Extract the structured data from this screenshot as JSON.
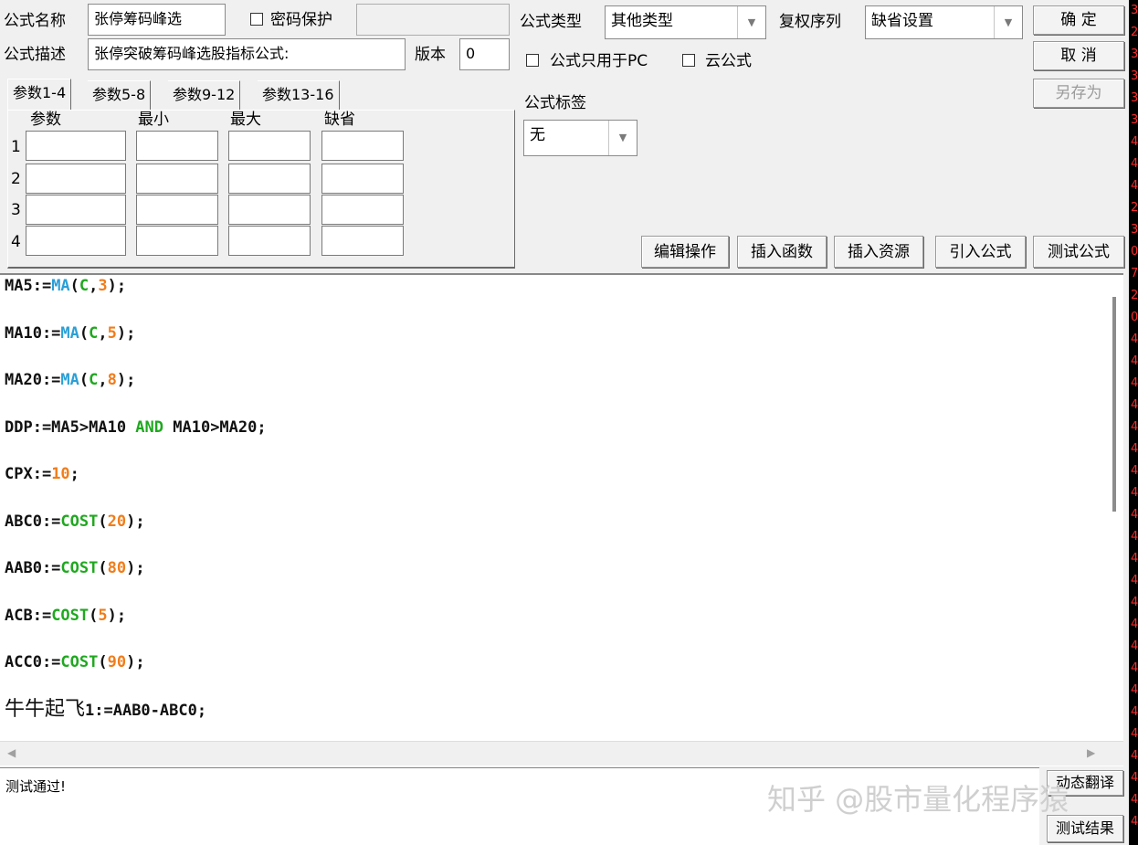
{
  "formula": {
    "name_label": "公式名称",
    "name_value": "张停筹码峰选",
    "password_label": "密码保护",
    "desc_label": "公式描述",
    "desc_value": "张停突破筹码峰选股指标公式:",
    "version_label": "版本",
    "version_value": "0",
    "type_label": "公式类型",
    "type_value": "其他类型",
    "restore_label": "复权序列",
    "restore_value": "缺省设置",
    "pc_only_label": "公式只用于PC",
    "cloud_label": "云公式",
    "tag_label": "公式标签",
    "tag_value": "无"
  },
  "buttons": {
    "ok": "确 定",
    "cancel": "取 消",
    "save_as": "另存为",
    "edit_ops": "编辑操作",
    "insert_func": "插入函数",
    "insert_res": "插入资源",
    "import_formula": "引入公式",
    "test_formula": "测试公式",
    "translate": "动态翻译",
    "test_result": "测试结果"
  },
  "param_tabs": [
    "参数1-4",
    "参数5-8",
    "参数9-12",
    "参数13-16"
  ],
  "param_headers": [
    "参数",
    "最小",
    "最大",
    "缺省"
  ],
  "param_rows": [
    "1",
    "2",
    "3",
    "4"
  ],
  "code_lines": [
    [
      {
        "t": "MA5:=",
        "c": ""
      },
      {
        "t": "MA",
        "c": "fn"
      },
      {
        "t": "(",
        "c": ""
      },
      {
        "t": "C",
        "c": "grn"
      },
      {
        "t": ",",
        "c": ""
      },
      {
        "t": "3",
        "c": "num"
      },
      {
        "t": ");",
        "c": ""
      }
    ],
    [
      {
        "t": "MA10:=",
        "c": ""
      },
      {
        "t": "MA",
        "c": "fn"
      },
      {
        "t": "(",
        "c": ""
      },
      {
        "t": "C",
        "c": "grn"
      },
      {
        "t": ",",
        "c": ""
      },
      {
        "t": "5",
        "c": "num"
      },
      {
        "t": ");",
        "c": ""
      }
    ],
    [
      {
        "t": "MA20:=",
        "c": ""
      },
      {
        "t": "MA",
        "c": "fn"
      },
      {
        "t": "(",
        "c": ""
      },
      {
        "t": "C",
        "c": "grn"
      },
      {
        "t": ",",
        "c": ""
      },
      {
        "t": "8",
        "c": "num"
      },
      {
        "t": ");",
        "c": ""
      }
    ],
    [
      {
        "t": "DDP:=MA5>MA10 ",
        "c": ""
      },
      {
        "t": "AND",
        "c": "grn"
      },
      {
        "t": " MA10>MA20;",
        "c": ""
      }
    ],
    [
      {
        "t": "CPX:=",
        "c": ""
      },
      {
        "t": "10",
        "c": "num"
      },
      {
        "t": ";",
        "c": ""
      }
    ],
    [
      {
        "t": "ABC0:=",
        "c": ""
      },
      {
        "t": "COST",
        "c": "grn"
      },
      {
        "t": "(",
        "c": ""
      },
      {
        "t": "20",
        "c": "num"
      },
      {
        "t": ");",
        "c": ""
      }
    ],
    [
      {
        "t": "AAB0:=",
        "c": ""
      },
      {
        "t": "COST",
        "c": "grn"
      },
      {
        "t": "(",
        "c": ""
      },
      {
        "t": "80",
        "c": "num"
      },
      {
        "t": ");",
        "c": ""
      }
    ],
    [
      {
        "t": "ACB:=",
        "c": ""
      },
      {
        "t": "COST",
        "c": "grn"
      },
      {
        "t": "(",
        "c": ""
      },
      {
        "t": "5",
        "c": "num"
      },
      {
        "t": ");",
        "c": ""
      }
    ],
    [
      {
        "t": "ACC0:=",
        "c": ""
      },
      {
        "t": "COST",
        "c": "grn"
      },
      {
        "t": "(",
        "c": ""
      },
      {
        "t": "90",
        "c": "num"
      },
      {
        "t": ");",
        "c": ""
      }
    ],
    [
      {
        "t": "牛牛起飞",
        "c": "cjk"
      },
      {
        "t": "1:=AAB0-ABC0;",
        "c": ""
      }
    ]
  ],
  "output_text": "测试通过!",
  "watermark": "知乎 @股市量化程序猿",
  "right_strip_chars": [
    "3",
    "2",
    "3",
    "3",
    "3",
    "3",
    "4",
    "4",
    "4",
    "2",
    "3",
    "0",
    "7",
    "2",
    "0",
    "4",
    "4",
    "4",
    "4",
    "4",
    "4",
    "4",
    "4",
    "4",
    "4",
    "4",
    "4",
    "4",
    "4",
    "4",
    "4",
    "4",
    "4",
    "4",
    "4",
    "4",
    "4",
    "4"
  ],
  "colors": {
    "function": "#2a9fd6",
    "number": "#f07d1a",
    "keyword": "#1fa81f",
    "strip_text": "#ff2a2a"
  },
  "icons": {
    "dropdown": "chevron-down-icon",
    "scroll_left": "scroll-left-icon",
    "scroll_right": "scroll-right-icon"
  }
}
